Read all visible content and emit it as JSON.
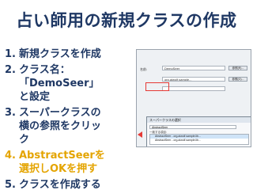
{
  "title": "占い師用の新規クラスの作成",
  "steps": [
    {
      "num": "1.",
      "text": "新規クラスを作成"
    },
    {
      "num": "2.",
      "text_before": "クラス名：「",
      "bold": "Demo",
      "text_after": "Seer」と設定"
    },
    {
      "num": "3.",
      "text": "スーパークラスの横の参照をクリック"
    },
    {
      "num": "4.",
      "text": "AbstractSeerを選択しOKを押す"
    },
    {
      "num": "5.",
      "text": "クラスを作成する"
    }
  ],
  "dialog": {
    "name_label": "名前:",
    "name_value": "DemoSeer",
    "super_value": "org.aiwolf.sample...",
    "browse_label": "参照(R)...",
    "browse2_label": "参照(O)...",
    "sub_title": "スーパークラスの選択",
    "sub_search": "AbstractSeer",
    "sub_list_label": "一致する項目:",
    "items": [
      "AbstractSeer - org.aiwolf.sample.lib...",
      "AbstractSeer - org.aiwolf.sample.lib..."
    ]
  },
  "colors": {
    "title": "#1f3864",
    "highlight": "#e4a400",
    "callout": "#e53935"
  }
}
